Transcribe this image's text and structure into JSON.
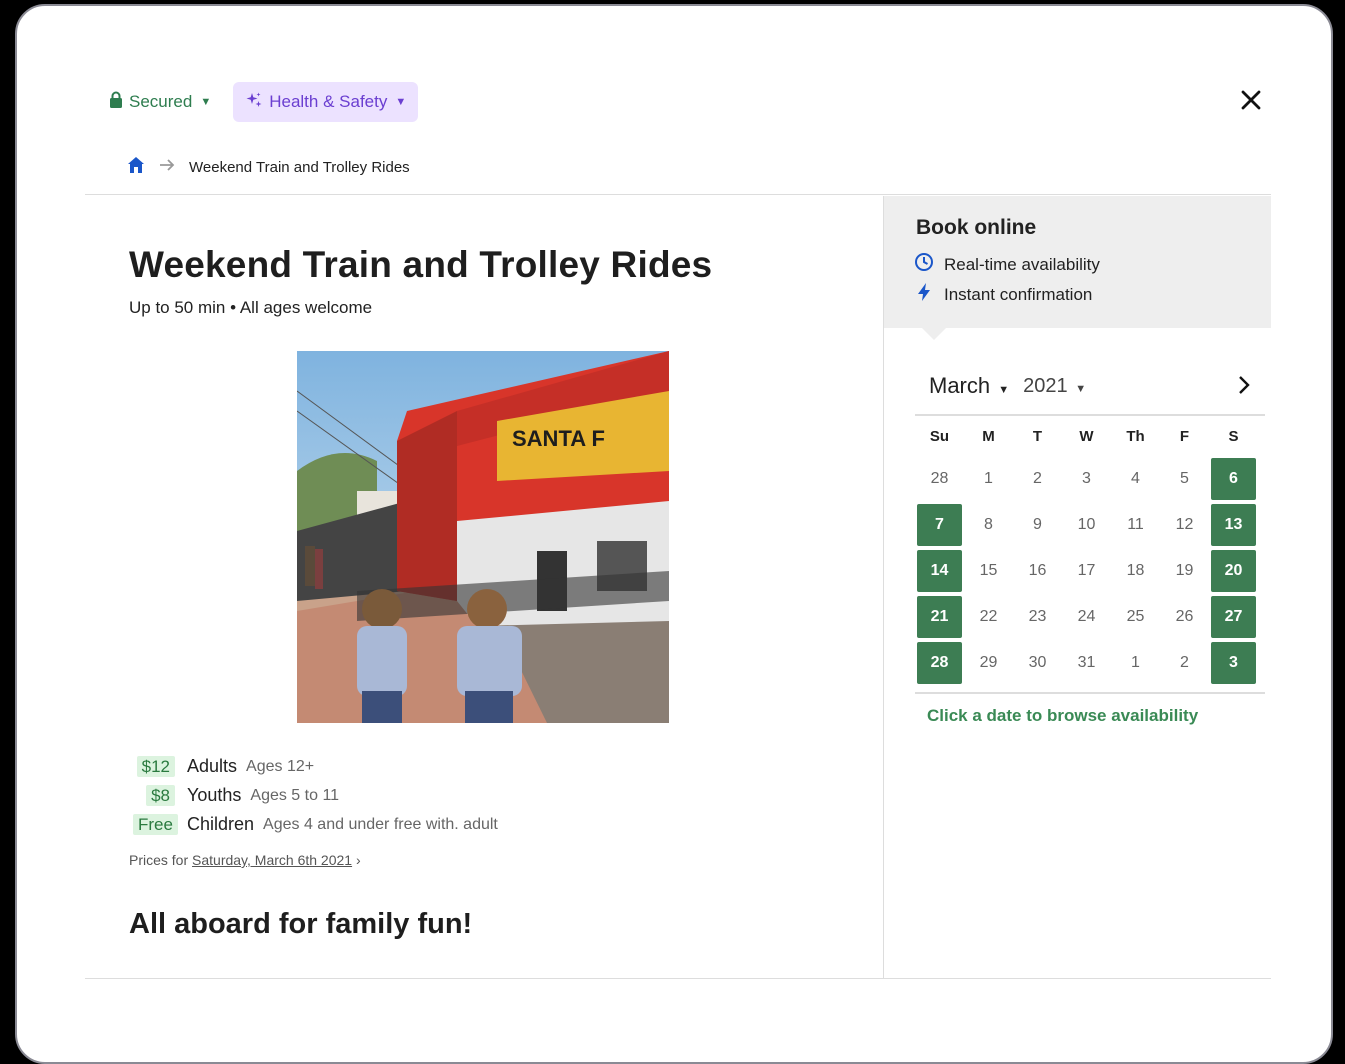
{
  "header": {
    "secured_label": "Secured",
    "health_label": "Health & Safety",
    "icons": {
      "secured": "lock-icon",
      "health": "sparkles-icon",
      "close": "close-icon"
    },
    "colors": {
      "secured": "#2e7d4f",
      "health_bg": "#ece2ff",
      "health_text": "#6b3fd1"
    }
  },
  "breadcrumb": {
    "home_icon": "home-icon",
    "separator_icon": "arrow-right-icon",
    "current": "Weekend Train and Trolley Rides"
  },
  "event": {
    "title": "Weekend Train and Trolley Rides",
    "subtitle": "Up to 50 min • All ages welcome",
    "photo": "train-photo",
    "prices": [
      {
        "price": "$12",
        "name": "Adults",
        "ages": "Ages 12+"
      },
      {
        "price": "$8",
        "name": "Youths",
        "ages": "Ages 5 to 11"
      },
      {
        "price": "Free",
        "name": "Children",
        "ages": "Ages 4 and under free with. adult"
      }
    ],
    "prices_for_label": "Prices for",
    "prices_for_date": "Saturday, March 6th 2021",
    "prices_for_chevron": "›",
    "section_heading": "All aboard for family fun!"
  },
  "booking": {
    "title": "Book online",
    "features": [
      {
        "icon": "clock-icon",
        "label": "Real-time availability"
      },
      {
        "icon": "lightning-icon",
        "label": "Instant confirmation"
      }
    ]
  },
  "calendar": {
    "month": "March",
    "year": "2021",
    "weekdays": [
      "Su",
      "M",
      "T",
      "W",
      "Th",
      "F",
      "S"
    ],
    "weeks": [
      [
        {
          "d": "28",
          "a": false
        },
        {
          "d": "1",
          "a": false
        },
        {
          "d": "2",
          "a": false
        },
        {
          "d": "3",
          "a": false
        },
        {
          "d": "4",
          "a": false
        },
        {
          "d": "5",
          "a": false
        },
        {
          "d": "6",
          "a": true
        }
      ],
      [
        {
          "d": "7",
          "a": true
        },
        {
          "d": "8",
          "a": false
        },
        {
          "d": "9",
          "a": false
        },
        {
          "d": "10",
          "a": false
        },
        {
          "d": "11",
          "a": false
        },
        {
          "d": "12",
          "a": false
        },
        {
          "d": "13",
          "a": true
        }
      ],
      [
        {
          "d": "14",
          "a": true
        },
        {
          "d": "15",
          "a": false
        },
        {
          "d": "16",
          "a": false
        },
        {
          "d": "17",
          "a": false
        },
        {
          "d": "18",
          "a": false
        },
        {
          "d": "19",
          "a": false
        },
        {
          "d": "20",
          "a": true
        }
      ],
      [
        {
          "d": "21",
          "a": true
        },
        {
          "d": "22",
          "a": false
        },
        {
          "d": "23",
          "a": false
        },
        {
          "d": "24",
          "a": false
        },
        {
          "d": "25",
          "a": false
        },
        {
          "d": "26",
          "a": false
        },
        {
          "d": "27",
          "a": true
        }
      ],
      [
        {
          "d": "28",
          "a": true
        },
        {
          "d": "29",
          "a": false
        },
        {
          "d": "30",
          "a": false
        },
        {
          "d": "31",
          "a": false
        },
        {
          "d": "1",
          "a": false
        },
        {
          "d": "2",
          "a": false
        },
        {
          "d": "3",
          "a": true
        }
      ]
    ],
    "hint": "Click a date to browse availability",
    "available_color": "#3d7d53"
  }
}
